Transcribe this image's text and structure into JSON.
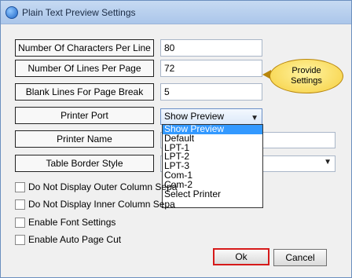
{
  "window": {
    "title": "Plain Text Preview Settings",
    "title_icon": "app-icon"
  },
  "fields": [
    {
      "label": "Number Of Characters Per Line",
      "value": "80"
    },
    {
      "label": "Number Of Lines Per Page",
      "value": "72"
    },
    {
      "label": "Blank Lines For Page Break",
      "value": "5"
    }
  ],
  "printer_port": {
    "label": "Printer Port",
    "selected": "Show Preview",
    "options": [
      "Show Preview",
      "Default",
      "LPT-1",
      "LPT-2",
      "LPT-3",
      "Com-1",
      "Com-2",
      "Select Printer"
    ]
  },
  "printer_name": {
    "label": "Printer Name"
  },
  "table_border": {
    "label": "Table Border Style"
  },
  "checkboxes": [
    {
      "label": "Do Not Display Outer Column Sepa",
      "checked": false
    },
    {
      "label": "Do Not Display Inner Column Sepa",
      "checked": false
    },
    {
      "label": "Enable Font Settings",
      "checked": false
    },
    {
      "label": "Enable Auto Page Cut",
      "checked": false
    }
  ],
  "tooltip": {
    "line1": "Provide",
    "line2": "Settings"
  },
  "buttons": {
    "ok": "Ok",
    "cancel": "Cancel"
  }
}
